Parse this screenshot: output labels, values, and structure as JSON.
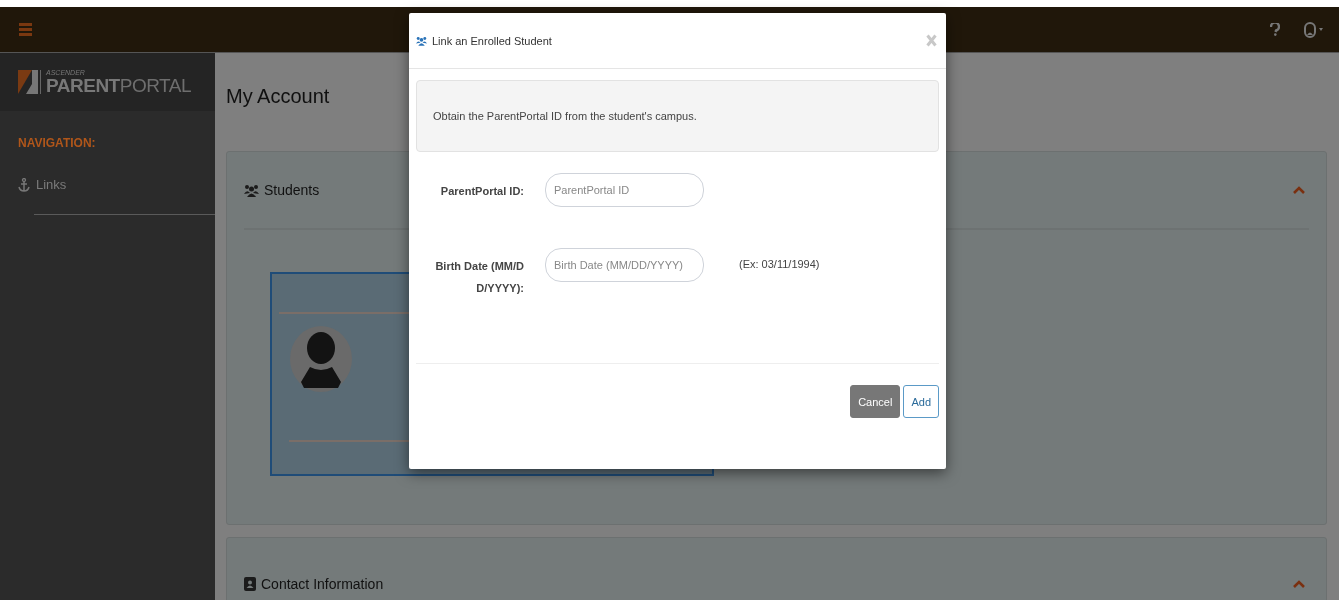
{
  "sidebar": {
    "logo": {
      "small": "ASCENDER",
      "bold": "PARENT",
      "light": "PORTAL"
    },
    "heading": "NAVIGATION:",
    "items": [
      {
        "label": "Links"
      }
    ]
  },
  "main": {
    "title": "My Account",
    "panels": [
      {
        "kind": "students",
        "title": "Students",
        "expanded": true
      },
      {
        "kind": "contact",
        "title": "Contact Information",
        "expanded": true
      }
    ]
  },
  "modal": {
    "title": "Link an Enrolled Student",
    "notice": "Obtain the ParentPortal ID from the student's campus.",
    "fields": [
      {
        "label": "ParentPortal ID:",
        "placeholder": "ParentPortal ID"
      },
      {
        "label": "Birth Date (MM/DD/YYYY):",
        "placeholder": "Birth Date (MM/DD/YYYY)",
        "hint": "(Ex: 03/11/1994)"
      }
    ],
    "buttons": [
      {
        "label": "Cancel",
        "kind": "secondary"
      },
      {
        "label": "Add",
        "kind": "primary"
      }
    ]
  }
}
